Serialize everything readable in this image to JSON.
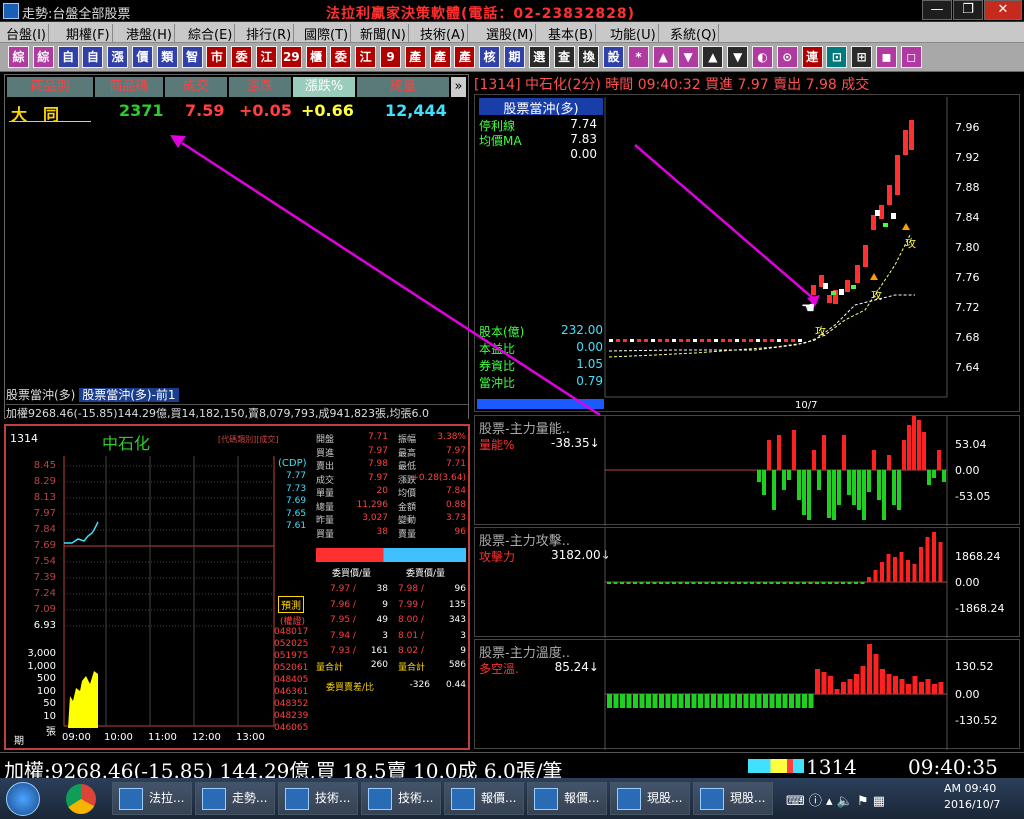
{
  "window": {
    "title": "走勢:台盤全部股票",
    "ad": "法拉利贏家決策軟體(電話：02-23832828)"
  },
  "menu": [
    "台盤(I)",
    "期權(F)",
    "港盤(H)",
    "綜合(E)",
    "排行(R)",
    "國際(T)",
    "新聞(N)",
    "技術(A)",
    "選股(M)",
    "基本(B)",
    "功能(U)",
    "系統(Q)"
  ],
  "toolbar": [
    "綜",
    "綜",
    "自",
    "自",
    "漲",
    "價",
    "類",
    "智",
    "市",
    "委",
    "江",
    "29",
    "櫃",
    "委",
    "江",
    "9",
    "產",
    "產",
    "產",
    "核",
    "期",
    "選",
    "查",
    "換",
    "設",
    "*",
    "▲",
    "▼",
    "▲",
    "▼",
    "◐",
    "⊙",
    "連",
    "⊡",
    "⊞",
    "◼",
    "◻"
  ],
  "quote_table": {
    "headers": [
      "商品別",
      "商品碼",
      "成交",
      "漲跌",
      "漲跌%",
      "總量"
    ],
    "row": {
      "name": "大　同",
      "code": "2371",
      "price": "7.59",
      "change": "+0.05",
      "pct": "+0.66",
      "volume": "12,444"
    }
  },
  "tabs": [
    "股票當沖(多)",
    "股票當沖(多)-前1"
  ],
  "index_line": "加權9268.46(-15.85)144.29億,買14,182,150,賣8,079,793,成941,823張,均張6.0",
  "mini_chart": {
    "code": "1314",
    "name": "中石化",
    "note": "[代碼類別][成交]",
    "cdp_label": "(CDP)",
    "cdp_values": [
      "7.77",
      "7.73",
      "7.69",
      "7.65",
      "7.61"
    ],
    "y_labels": [
      "8.45",
      "8.29",
      "8.13",
      "7.97",
      "7.84",
      "7.69",
      "7.54",
      "7.39",
      "7.24",
      "7.09",
      "6.93"
    ],
    "vol_labels": [
      "3,000",
      "1,000",
      "500",
      "100",
      "50",
      "10",
      "張"
    ],
    "x_labels": [
      "期",
      "09:00",
      "10:00",
      "11:00",
      "12:00",
      "13:00"
    ],
    "predict": "預測",
    "rights": "(權證)",
    "rights_list": [
      "048017",
      "052025",
      "051975",
      "052061",
      "048405",
      "046361",
      "048352",
      "048239",
      "046065"
    ],
    "quote": [
      [
        "開盤",
        "7.71",
        "振幅",
        "3.38%"
      ],
      [
        "買進",
        "7.97",
        "最高",
        "7.97"
      ],
      [
        "賣出",
        "7.98",
        "最低",
        "7.71"
      ],
      [
        "成交",
        "7.97",
        "漲跌",
        "+0.28(3.64)"
      ],
      [
        "單量",
        "20",
        "均價",
        "7.84"
      ],
      [
        "總量",
        "11,296",
        "金額",
        "0.88"
      ],
      [
        "昨量",
        "3,027",
        "變動",
        "3.73"
      ],
      [
        "買量",
        "38",
        "賣量",
        "96"
      ]
    ],
    "book_headers": [
      "委買價/量",
      "委賣價/量"
    ],
    "book": [
      [
        "7.97",
        "38",
        "7.98",
        "96"
      ],
      [
        "7.96",
        "9",
        "7.99",
        "135"
      ],
      [
        "7.95",
        "49",
        "8.00",
        "343"
      ],
      [
        "7.94",
        "3",
        "8.01",
        "3"
      ],
      [
        "7.93",
        "161",
        "8.02",
        "9"
      ]
    ],
    "book_total": [
      "量合計",
      "260",
      "量合計",
      "586"
    ],
    "book_diff": [
      "委買賣差/比",
      "-326",
      "0.44"
    ]
  },
  "main_chart": {
    "title": "[1314] 中石化(2分) 時間 09:40:32 買進 7.97 賣出 7.98 成交",
    "legend_title": "股票當沖(多)",
    "indicators": [
      [
        "停利線",
        "7.74"
      ],
      [
        "均價MA",
        "7.83"
      ],
      [
        "",
        "0.00"
      ]
    ],
    "fundamentals": [
      [
        "股本(億)",
        "232.00"
      ],
      [
        "本益比",
        "0.00"
      ],
      [
        "券資比",
        "1.05"
      ],
      [
        "當沖比",
        "0.79"
      ]
    ],
    "y_labels": [
      "7.96",
      "7.92",
      "7.88",
      "7.84",
      "7.80",
      "7.76",
      "7.72",
      "7.68",
      "7.64"
    ],
    "x_label": "10/7",
    "tag": "攻"
  },
  "sub1": {
    "title": "股票-主力量能..",
    "label": "量能%",
    "value": "-38.35↓",
    "y_labels": [
      "53.04",
      "0.00",
      "-53.05"
    ],
    "bars": [
      0,
      0,
      0,
      0,
      0,
      0,
      0,
      0,
      0,
      0,
      0,
      0,
      0,
      0,
      0,
      0,
      0,
      0,
      0,
      0,
      0,
      0,
      0,
      0,
      0,
      0,
      0,
      0,
      0,
      0,
      -12,
      -25,
      30,
      -40,
      35,
      -20,
      -10,
      40,
      -30,
      -45,
      -50,
      20,
      -20,
      35,
      -48,
      -50,
      -35,
      35,
      -25,
      -35,
      -40,
      -50,
      -22,
      20,
      -30,
      -50,
      15,
      -35,
      -40,
      30,
      45,
      55,
      50,
      38,
      -15,
      -8,
      20,
      -12
    ]
  },
  "sub2": {
    "title": "股票-主力攻擊..",
    "label": "攻擊力",
    "value": "3182.00↓",
    "y_labels": [
      "1868.24",
      "0.00",
      "-1868.24"
    ]
  },
  "sub3": {
    "title": "股票-主力溫度..",
    "label": "多空溫.",
    "value": "85.24↓",
    "y_labels": [
      "130.52",
      "0.00",
      "-130.52"
    ]
  },
  "status": {
    "text": "加權:9268.46(-15.85) 144.29億,買 18.5賣 10.0成 6.0張/筆",
    "code": "1314",
    "time": "09:40:35"
  },
  "taskbar": {
    "items": [
      "法拉...",
      "走勢...",
      "技術...",
      "技術...",
      "報價...",
      "報價...",
      "現股...",
      "現股..."
    ],
    "clock_time": "AM 09:40",
    "clock_date": "2016/10/7"
  }
}
